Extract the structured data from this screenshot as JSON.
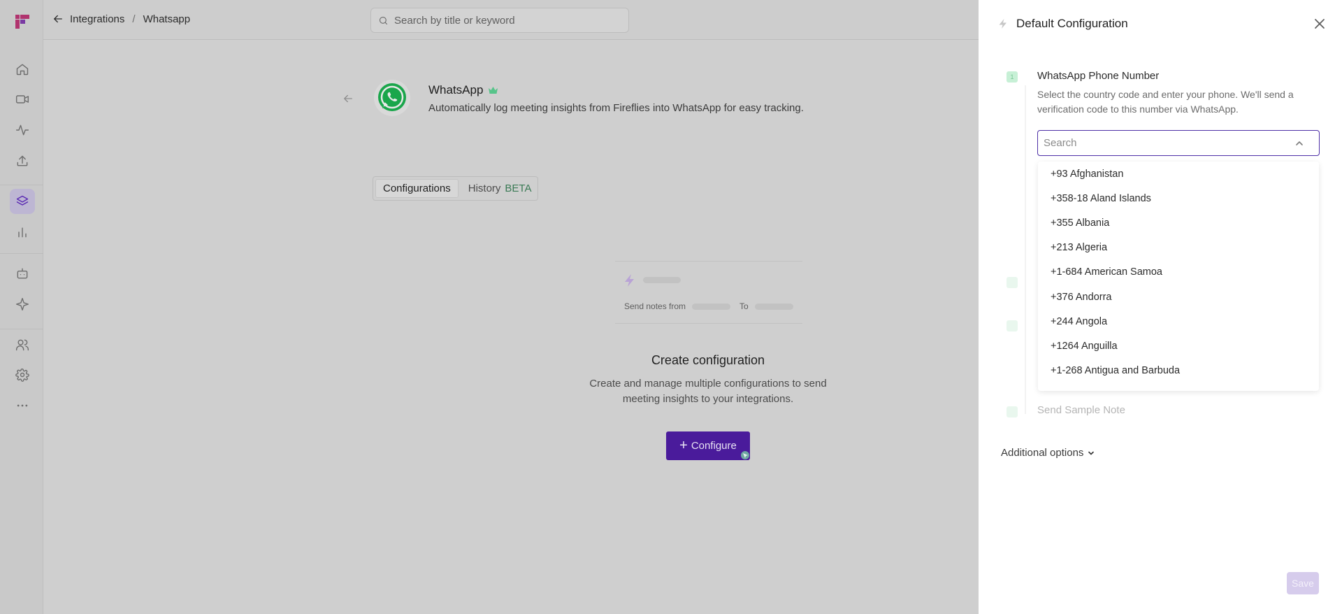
{
  "header": {
    "breadcrumb": [
      "Integrations",
      "Whatsapp"
    ],
    "breadcrumb_separator": "/",
    "search_placeholder": "Search by title or keyword"
  },
  "sidebar": {
    "icons": [
      "home-icon",
      "video-icon",
      "activity-icon",
      "upload-icon",
      "layers-icon",
      "bar-chart-icon",
      "bot-icon",
      "sparkle-icon",
      "users-icon",
      "settings-icon",
      "more-icon"
    ],
    "active": "layers-icon"
  },
  "app": {
    "name": "WhatsApp",
    "description": "Automatically log meeting insights from Fireflies into WhatsApp for easy tracking."
  },
  "tabs": [
    {
      "label": "Configurations",
      "selected": true
    },
    {
      "label": "History",
      "badge": "BETA"
    }
  ],
  "preview": {
    "send_notes_label": "Send notes from",
    "to_label": "To"
  },
  "empty_state": {
    "title": "Create configuration",
    "description": "Create and manage multiple configurations to send meeting insights to your integrations.",
    "button_label": "Configure"
  },
  "panel": {
    "title": "Default Configuration",
    "field_title": "WhatsApp Phone Number",
    "field_description": "Select the country code and enter your phone. We'll send a verification code to this number via WhatsApp.",
    "search_placeholder": "Search",
    "countries": [
      "+93 Afghanistan",
      "+358-18 Aland Islands",
      "+355 Albania",
      "+213 Algeria",
      "+1-684 American Samoa",
      "+376 Andorra",
      "+244 Angola",
      "+1264 Anguilla",
      "+1-268 Antigua and Barbuda"
    ],
    "sample_note_label": "Send Sample Note",
    "additional_options_label": "Additional options",
    "save_label": "Save"
  },
  "colors": {
    "accent": "#4a1b9b",
    "whatsapp_green": "#25d366",
    "step_green": "#c7f0d6",
    "focus_border": "#4d2fa6"
  }
}
